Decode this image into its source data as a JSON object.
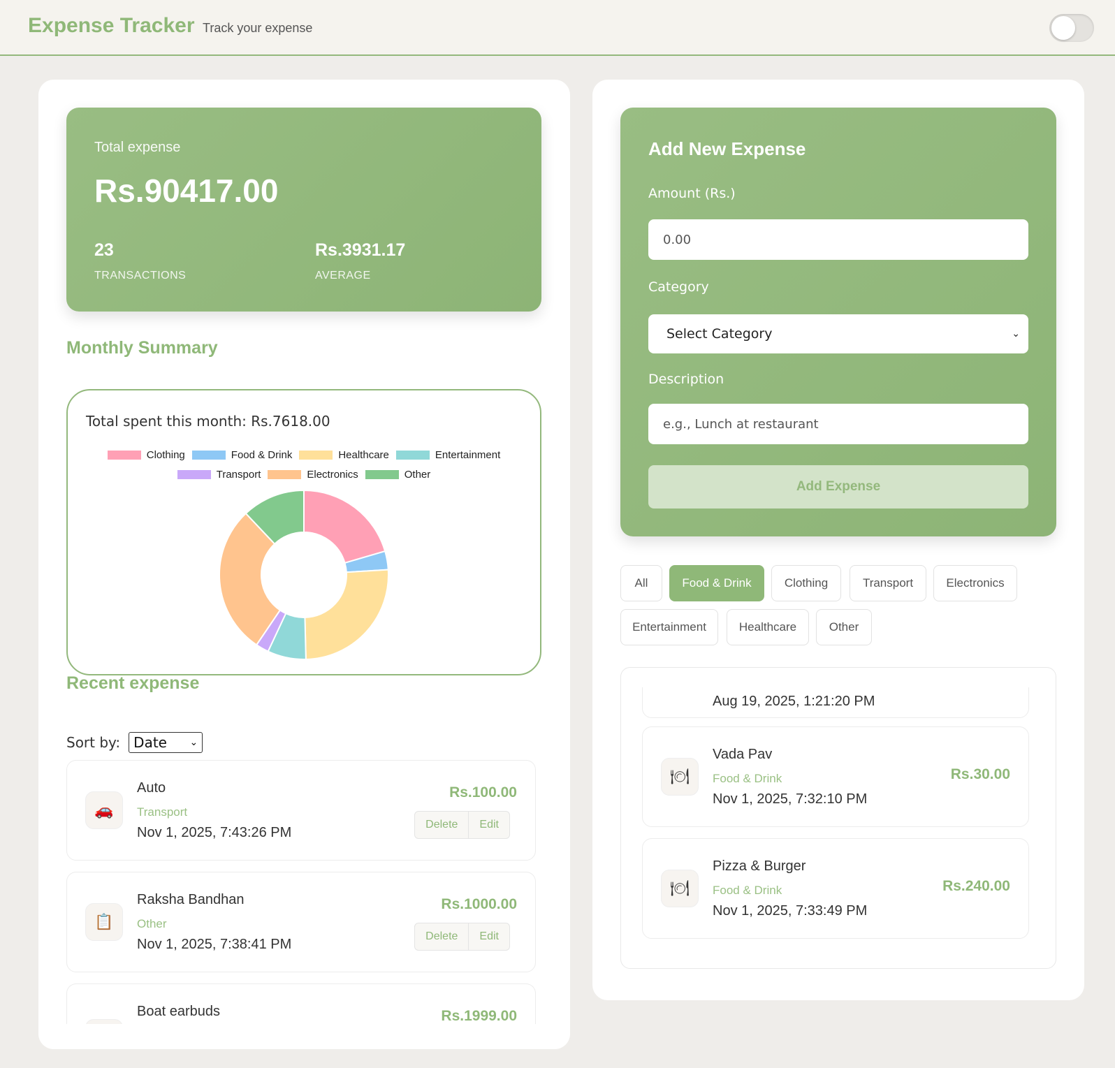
{
  "header": {
    "title": "Expense Tracker",
    "subtitle": "Track your expense"
  },
  "stats": {
    "total_label": "Total expense",
    "total_value": "Rs.90417.00",
    "transactions_value": "23",
    "transactions_label": "TRANSACTIONS",
    "average_value": "Rs.3931.17",
    "average_label": "AVERAGE"
  },
  "monthly": {
    "heading": "Monthly Summary",
    "total_text": "Total spent this month: Rs.7618.00"
  },
  "chart_data": {
    "type": "pie",
    "donut": true,
    "categories": [
      "Clothing",
      "Food & Drink",
      "Healthcare",
      "Entertainment",
      "Transport",
      "Electronics",
      "Other"
    ],
    "values": [
      1560,
      270,
      1950,
      560,
      190,
      2170,
      918
    ],
    "colors": [
      "#ffa0b5",
      "#8ec8f5",
      "#ffe09a",
      "#90d8d8",
      "#c9a8f9",
      "#ffc48e",
      "#82c98d"
    ],
    "legend_position": "top"
  },
  "recent": {
    "heading": "Recent expense",
    "sort_label": "Sort by:",
    "sort_value": "Date",
    "items": [
      {
        "title": "Auto",
        "category": "Transport",
        "date": "Nov 1, 2025, 7:43:26 PM",
        "amount": "Rs.100.00",
        "icon": "car-icon",
        "glyph": "🚗",
        "delete": "Delete",
        "edit": "Edit"
      },
      {
        "title": "Raksha Bandhan",
        "category": "Other",
        "date": "Nov 1, 2025, 7:38:41 PM",
        "amount": "Rs.1000.00",
        "icon": "clipboard-icon",
        "glyph": "📋",
        "delete": "Delete",
        "edit": "Edit"
      },
      {
        "title": "Boat earbuds",
        "category": "",
        "date": "",
        "amount": "Rs.1999.00",
        "icon": "",
        "glyph": ""
      }
    ]
  },
  "form": {
    "title": "Add New Expense",
    "amount_label": "Amount (Rs.)",
    "amount_placeholder": "0.00",
    "category_label": "Category",
    "category_value": "Select Category",
    "description_label": "Description",
    "description_placeholder": "e.g., Lunch at restaurant",
    "submit_label": "Add Expense"
  },
  "filters": {
    "active": "Food & Drink",
    "items": [
      "All",
      "Food & Drink",
      "Clothing",
      "Transport",
      "Electronics",
      "Entertainment",
      "Healthcare",
      "Other"
    ]
  },
  "filtered_list": {
    "partial_date": "Aug 19, 2025, 1:21:20 PM",
    "items": [
      {
        "title": "Vada Pav",
        "category": "Food & Drink",
        "date": "Nov 1, 2025, 7:32:10 PM",
        "amount": "Rs.30.00",
        "icon": "plate-icon",
        "glyph": "🍽"
      },
      {
        "title": "Pizza & Burger",
        "category": "Food & Drink",
        "date": "Nov 1, 2025, 7:33:49 PM",
        "amount": "Rs.240.00",
        "icon": "plate-icon",
        "glyph": "🍽"
      }
    ]
  }
}
